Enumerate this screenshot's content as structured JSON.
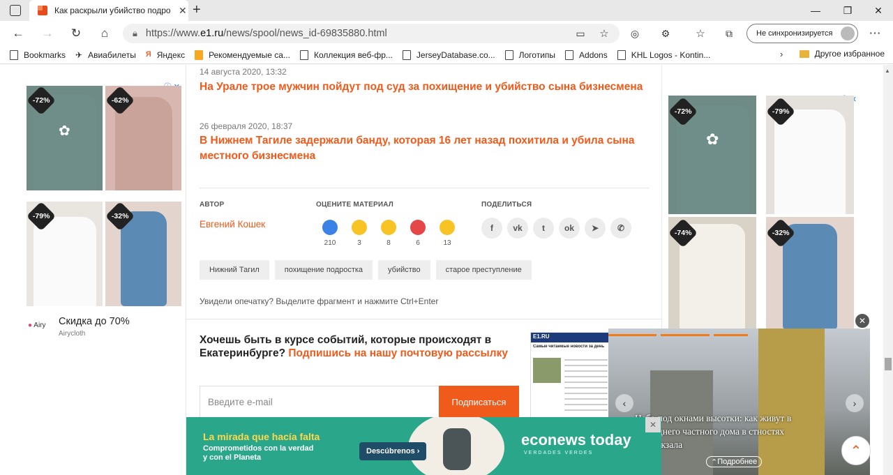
{
  "browser": {
    "tab_title": "Как раскрыли убийство подрос",
    "url_prefix": "https://www.",
    "url_domain": "e1.ru",
    "url_path": "/news/spool/news_id-69835880.html",
    "sync_label": "Не синхронизируется",
    "bookmarks": [
      "Bookmarks",
      "Авиабилеты",
      "Яндекс",
      "Рекомендуемые са...",
      "Коллекция веб-фр...",
      "JerseyDatabase.co...",
      "Логотипы",
      "Addons",
      "KHL Logos - Kontin..."
    ],
    "other_bookmarks": "Другое избранное"
  },
  "related": [
    {
      "date": "14 августа 2020, 13:32",
      "title": "На Урале трое мужчин пойдут под суд за похищение и убийство сына бизнесмена"
    },
    {
      "date": "26 февраля 2020, 18:37",
      "title": "В Нижнем Тагиле задержали банду, которая 16 лет назад похитила и убила сына местного бизнесмена"
    }
  ],
  "article_meta": {
    "author_label": "АВТОР",
    "author_name": "Евгений Кошек",
    "rate_label": "ОЦЕНИТЕ МАТЕРИАЛ",
    "share_label": "ПОДЕЛИТЬСЯ",
    "reactions": [
      {
        "icon": "like-icon",
        "count": "210",
        "color": "#3b82e6"
      },
      {
        "icon": "smile-icon",
        "count": "3",
        "color": "#f7c325"
      },
      {
        "icon": "surprised-icon",
        "count": "8",
        "color": "#f7c325"
      },
      {
        "icon": "angry-icon",
        "count": "6",
        "color": "#e54646"
      },
      {
        "icon": "sad-icon",
        "count": "13",
        "color": "#f7c325"
      }
    ],
    "share_icons": [
      "facebook-icon",
      "vk-icon",
      "twitter-icon",
      "ok-icon",
      "telegram-icon",
      "whatsapp-icon"
    ]
  },
  "tags": [
    "Нижний Тагил",
    "похищение подростка",
    "убийство",
    "старое преступление"
  ],
  "typo_hint": "Увидели опечатку? Выделите фрагмент и нажмите Ctrl+Enter",
  "newsletter": {
    "title": "Хочешь быть в курсе событий, которые происходят в Екатеринбурге?",
    "link": "Подпишись на нашу почтовую рассылку",
    "placeholder": "Введите e-mail",
    "button": "Подписаться"
  },
  "left_ad": {
    "badges": [
      "-72%",
      "-62%",
      "-79%",
      "-32%"
    ],
    "brand": "Airy",
    "headline": "Скидка до 70%",
    "advertiser": "Airycloth"
  },
  "right_ad": {
    "badges": [
      "-72%",
      "-79%",
      "-74%",
      "-32%"
    ]
  },
  "video_widget": {
    "logo": "E1.RU",
    "inner_heading": "Самые читаемые новости за день",
    "caption": "Небо под окнами высотки: как живут в последнего частного дома в стностях автовокзала",
    "more": "Подробнее"
  },
  "bottom_ad": {
    "line1": "La mirada que hacía falta",
    "line2": "Comprometidos con la verdad",
    "line3": "y con el Planeta",
    "cta": "Descúbrenos",
    "brand": "econews today",
    "brand_sub": "VERDADES VERDES"
  },
  "colors": {
    "accent": "#f05a1a",
    "ad_teal": "#2aa78a"
  }
}
